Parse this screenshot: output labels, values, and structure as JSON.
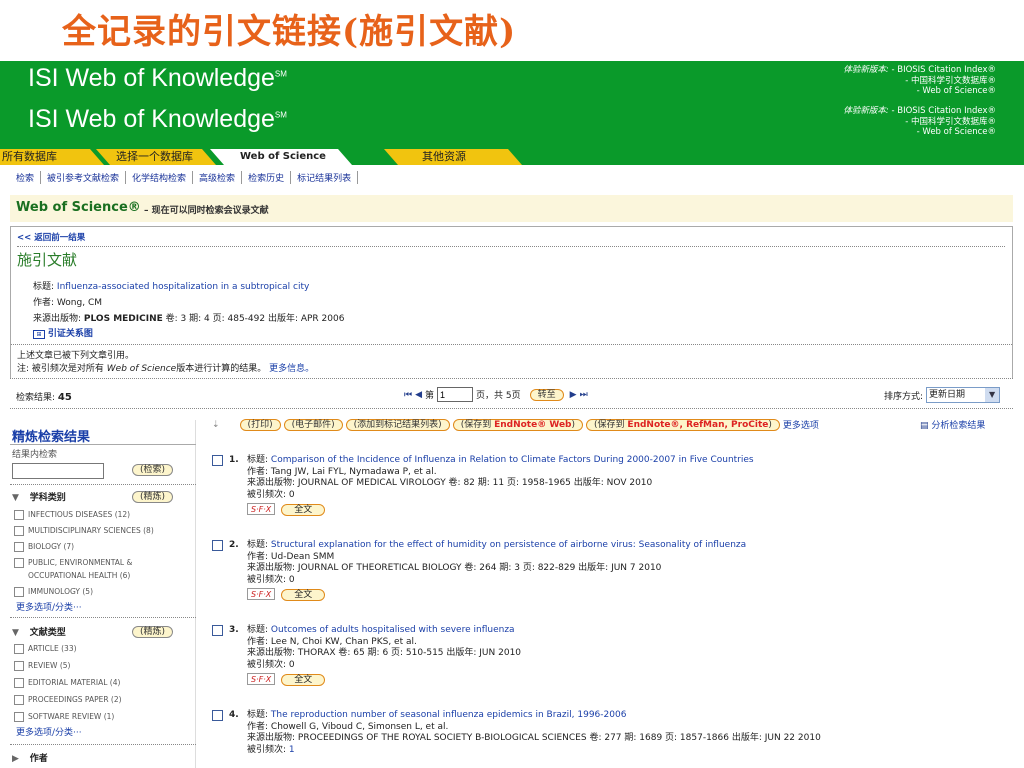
{
  "slide_title": "全记录的引文链接(施引文献)",
  "banner": {
    "logo": "ISI Web of Knowledge",
    "logo_mark": "SM",
    "edition_label": "体验新版本:",
    "editions": [
      "- BIOSIS Citation Index®",
      "- 中国科学引文数据库®",
      "- Web of Science®"
    ]
  },
  "tabs": {
    "all_db": "所有数据库",
    "select_db": "选择一个数据库",
    "wos": "Web of Science",
    "other": "其他资源"
  },
  "subnav": [
    "检索",
    "被引参考文献检索",
    "化学结构检索",
    "高级检索",
    "检索历史",
    "标记结果列表"
  ],
  "wos": {
    "title": "Web of Science®",
    "subtitle": "– 现在可以同时检索会议录文献"
  },
  "panel": {
    "back": "<< 返回前一结果",
    "heading": "施引文献",
    "title_label": "标题:",
    "title_value": "Influenza-associated hospitalization in a subtropical city",
    "author_label": "作者:",
    "author_value": "Wong, CM",
    "source_label": "来源出版物:",
    "source_journal": "PLOS MEDICINE",
    "source_rest": "卷: 3 期: 4 页: 485-492 出版年: APR 2006",
    "map_link": "引证关系图",
    "cited_note": "上述文章已被下列文章引用。",
    "note_prefix": "注: 被引频次是对所有",
    "note_wos": "Web of Science",
    "note_suffix": "版本进行计算的结果。",
    "more_info": "更多信息。"
  },
  "results_bar": {
    "label": "检索结果:",
    "count": "45",
    "page_prefix": "第",
    "page_value": "1",
    "page_suffix": "页，共 5页",
    "goto": "转至",
    "sort_label": "排序方式:",
    "sort_value": "更新日期"
  },
  "toolbar": {
    "print": "打印",
    "email": "电子邮件",
    "add_marked": "添加到标记结果列表",
    "save_endnote_web": "保存到",
    "endnote_web": "EndNote® Web",
    "save_endnote": "保存到",
    "endnote_refman": "EndNote®, RefMan, ProCite",
    "more": "更多选项",
    "analyze": "分析检索结果"
  },
  "sidebar": {
    "title": "精炼检索结果",
    "within_label": "结果内检索",
    "search_btn": "检索",
    "refine_btn": "精炼",
    "subject_title": "学科类别",
    "subjects": [
      "INFECTIOUS DISEASES (12)",
      "MULTIDISCIPLINARY SCIENCES (8)",
      "BIOLOGY (7)",
      "PUBLIC, ENVIRONMENTAL &",
      "OCCUPATIONAL HEALTH (6)",
      "IMMUNOLOGY (5)"
    ],
    "more_subjects": "更多选项/分类···",
    "doctype_title": "文献类型",
    "doctypes": [
      "ARTICLE (33)",
      "REVIEW (5)",
      "EDITORIAL MATERIAL (4)",
      "PROCEEDINGS PAPER (2)",
      "SOFTWARE REVIEW (1)"
    ],
    "more_doctypes": "更多选项/分类···",
    "author_title": "作者"
  },
  "records": [
    {
      "num": "1.",
      "title": "Comparison of the Incidence of Influenza in Relation to Climate Factors During 2000-2007 in Five Countries",
      "authors": "Tang JW, Lai FYL, Nymadawa P, et al.",
      "source": "JOURNAL OF MEDICAL VIROLOGY 卷: 82 期: 11 页: 1958-1965 出版年: NOV 2010",
      "cited": "0"
    },
    {
      "num": "2.",
      "title": "Structural explanation for the effect of humidity on persistence of airborne virus: Seasonality of influenza",
      "authors": "Ud-Dean SMM",
      "source": "JOURNAL OF THEORETICAL BIOLOGY 卷: 264 期: 3 页: 822-829 出版年: JUN 7 2010",
      "cited": "0"
    },
    {
      "num": "3.",
      "title": "Outcomes of adults hospitalised with severe influenza",
      "authors": "Lee N, Choi KW, Chan PKS, et al.",
      "source": "THORAX 卷: 65 期: 6 页: 510-515 出版年: JUN 2010",
      "cited": "0"
    },
    {
      "num": "4.",
      "title": "The reproduction number of seasonal influenza epidemics in Brazil, 1996-2006",
      "authors": "Chowell G, Viboud C, Simonsen L, et al.",
      "source": "PROCEEDINGS OF THE ROYAL SOCIETY B-BIOLOGICAL SCIENCES 卷: 277 期: 1689 页: 1857-1866 出版年: JUN 22 2010",
      "cited": "1"
    }
  ],
  "record_labels": {
    "title": "标题:",
    "author": "作者:",
    "source": "来源出版物:",
    "cited": "被引频次:",
    "sfx": "S·F·X",
    "full": "全文"
  }
}
